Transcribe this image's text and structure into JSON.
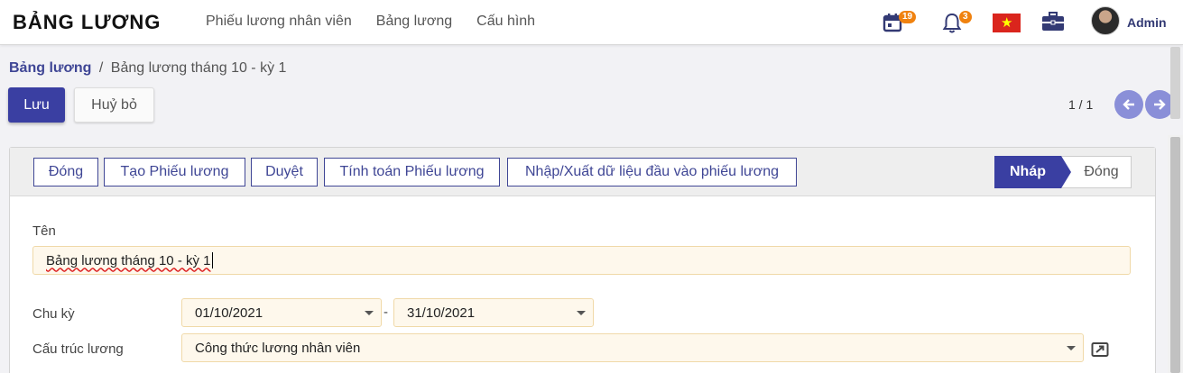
{
  "app": {
    "brand": "BẢNG LƯƠNG",
    "user": "Admin"
  },
  "menu": {
    "items": [
      "Phiếu lương nhân viên",
      "Bảng lương",
      "Cấu hình"
    ]
  },
  "systray": {
    "calendar_count": "19",
    "notification_count": "3"
  },
  "breadcrumb": {
    "parent": "Bảng lương",
    "separator": "/",
    "current": "Bảng lương tháng 10 - kỳ 1"
  },
  "actions": {
    "save": "Lưu",
    "discard": "Huỷ bỏ"
  },
  "pager": {
    "value": "1 / 1"
  },
  "header_buttons": [
    "Đóng",
    "Tạo Phiếu lương",
    "Duyệt",
    "Tính toán Phiếu lương",
    "Nhập/Xuất dữ liệu đầu vào phiếu lương"
  ],
  "stages": {
    "active": "Nháp",
    "next": "Đóng"
  },
  "form": {
    "name_label": "Tên",
    "name_value": "Bảng lương tháng 10 - kỳ 1",
    "period_label": "Chu kỳ",
    "date_from": "01/10/2021",
    "date_separator": "-",
    "date_to": "31/10/2021",
    "structure_label": "Cấu trúc lương",
    "structure_value": "Công thức lương nhân viên"
  },
  "colors": {
    "primary": "#3a3fa2",
    "badge": "#f0820f",
    "field_bg": "#fef8ec"
  }
}
